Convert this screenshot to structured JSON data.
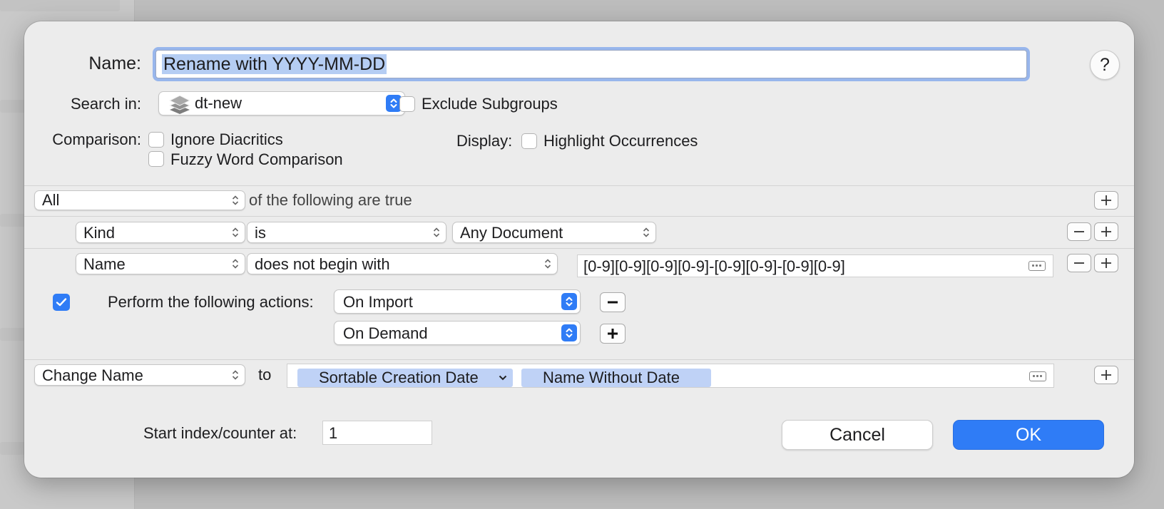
{
  "dialog": {
    "name_label": "Name:",
    "name_value": "Rename with YYYY-MM-DD",
    "help_label": "?",
    "search_in_label": "Search in:",
    "search_in_value": "dt-new",
    "exclude_subgroups_label": "Exclude Subgroups",
    "exclude_subgroups_checked": false,
    "comparison_label": "Comparison:",
    "ignore_diacritics_label": "Ignore Diacritics",
    "ignore_diacritics_checked": false,
    "fuzzy_label": "Fuzzy Word Comparison",
    "fuzzy_checked": false,
    "display_label": "Display:",
    "highlight_label": "Highlight Occurrences",
    "highlight_checked": false
  },
  "conditions": {
    "match_value": "All",
    "match_suffix": "of the following are true",
    "rows": [
      {
        "field": "Kind",
        "operator": "is",
        "value": "Any Document"
      },
      {
        "field": "Name",
        "operator": "does not begin with",
        "value": "[0-9][0-9][0-9][0-9]-[0-9][0-9]-[0-9][0-9]"
      }
    ]
  },
  "actions": {
    "perform_checked": true,
    "perform_label": "Perform the following actions:",
    "triggers": [
      "On Import",
      "On Demand"
    ]
  },
  "action_row": {
    "action": "Change Name",
    "to_label": "to",
    "tokens": [
      "Sortable Creation Date",
      "Name Without Date"
    ]
  },
  "footer": {
    "start_index_label": "Start index/counter at:",
    "start_index_value": "1",
    "cancel_label": "Cancel",
    "ok_label": "OK"
  },
  "colors": {
    "accent": "#2f7cf6",
    "selection": "#b5cdf3",
    "token": "#bfd2f6",
    "dialog_bg": "#ececec"
  }
}
